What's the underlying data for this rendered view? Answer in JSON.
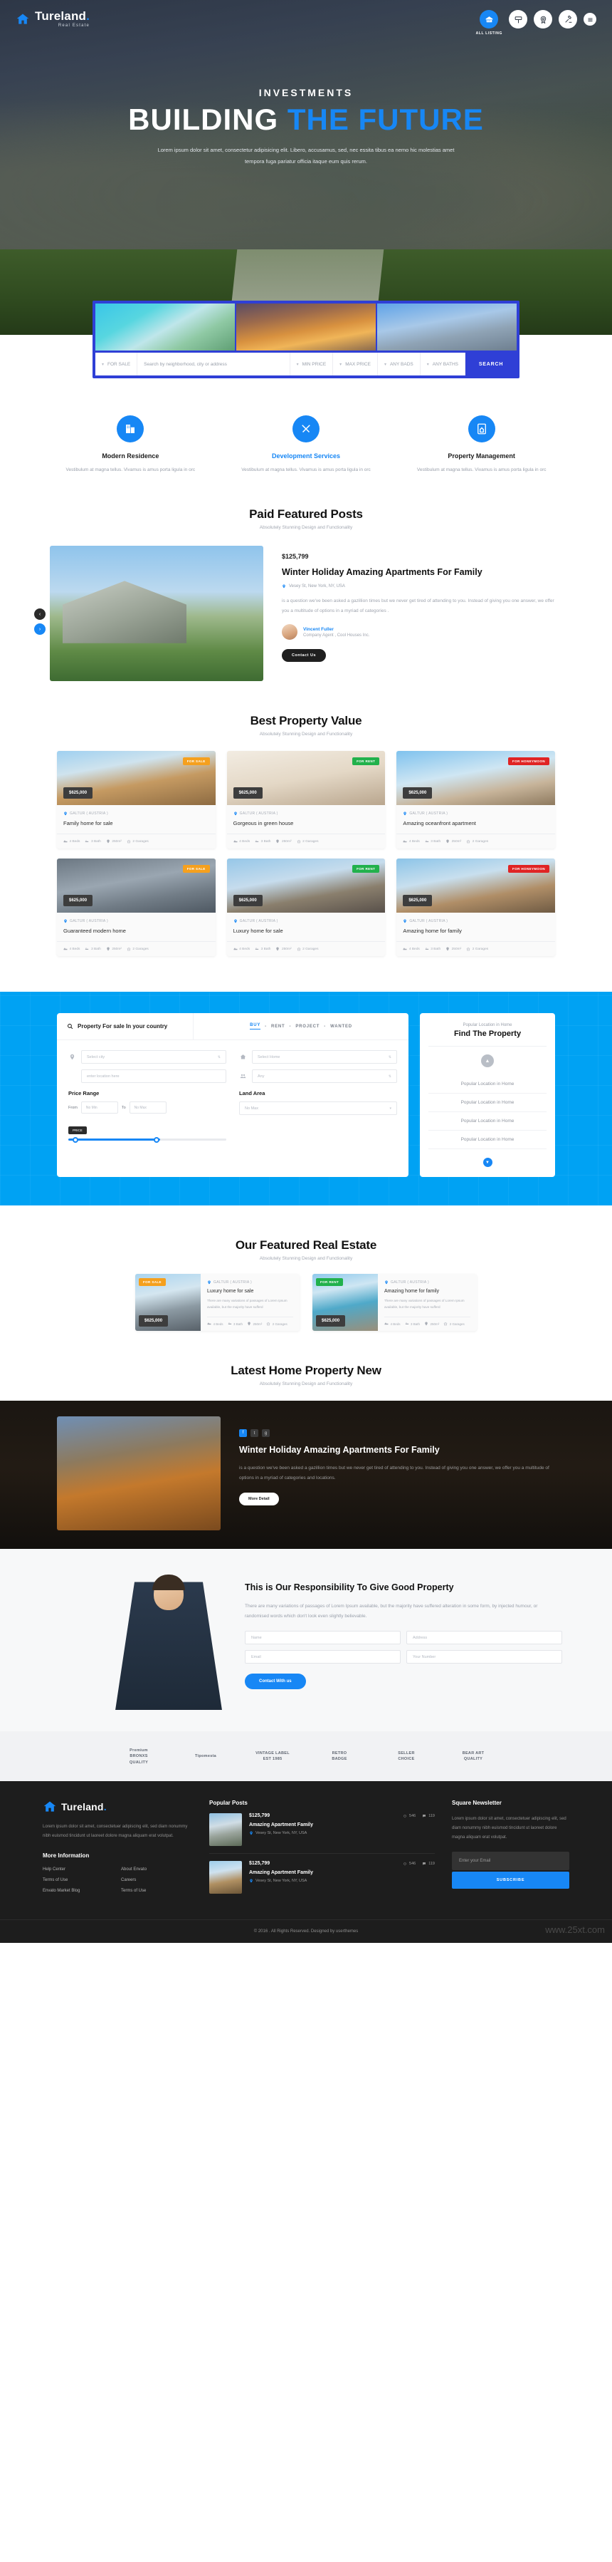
{
  "brand": {
    "name": "Tureland",
    "dot": ".",
    "tagline": "Real Estate"
  },
  "header": {
    "nav": [
      {
        "icon": "house-icon",
        "label": "ALL LISTING",
        "active": true
      },
      {
        "icon": "sign-board-icon",
        "label": "",
        "active": false
      },
      {
        "icon": "award-target-icon",
        "label": "",
        "active": false
      },
      {
        "icon": "gavel-icon",
        "label": "",
        "active": false
      }
    ],
    "menu_icon": "hamburger-menu-icon"
  },
  "hero": {
    "kicker": "INVESTMENTS",
    "title_white": "BUILDING",
    "title_accent": "THE FUTURE",
    "description": "Lorem ipsum dolor sit amet, consectetur adipisicing elit. Libero, accusamus, sed, nec essita tibus ea nemo hic molestias amet tempora fuga pariatur officia itaque eum quis rerum."
  },
  "search_bar": {
    "fields": [
      {
        "label": "FOR SALE",
        "type": "select"
      },
      {
        "label": "Search by neighborhood, city or address",
        "type": "text"
      },
      {
        "label": "MIN PRICE",
        "type": "select"
      },
      {
        "label": "MAX PRICE",
        "type": "select"
      },
      {
        "label": "ANY BADS",
        "type": "select"
      },
      {
        "label": "ANY BATHS",
        "type": "select"
      }
    ],
    "button": "SEARCH"
  },
  "services": [
    {
      "icon": "building-icon",
      "title": "Modern Residence",
      "desc": "Vestibulum at magna tellus. Vivamus is amus porta ligula in orc",
      "active": false
    },
    {
      "icon": "tools-icon",
      "title": "Development Services",
      "desc": "Vestibulum at magna tellus. Vivamus is amus porta ligula in orc",
      "active": true
    },
    {
      "icon": "home-document-icon",
      "title": "Property Management",
      "desc": "Vestibulum at magna tellus. Vivamus is amus porta ligula in orc",
      "active": false
    }
  ],
  "featured_section": {
    "title": "Paid Featured Posts",
    "subtitle": "Absolutely Stunning Design and Functionality",
    "post": {
      "price": "$125,799",
      "title": "Winter Holiday Amazing Apartments For Family",
      "location": "Vesey St, New York, NY, USA",
      "description": "is a question we've been asked a gazillion times but we never get tired of attending to you. Instead of giving you one answer, we offer you a multitude of options in a myriad of categories .",
      "agent_name": "Vincent Fuller",
      "agent_role": "Company Agent , Cool Houses Inc.",
      "button": "Contact Us"
    }
  },
  "best_value": {
    "title": "Best Property Value",
    "subtitle": "Absolutely Stunning Design and Functionality",
    "cards": [
      {
        "badge": "FOR SALE",
        "badge_type": "sale",
        "price": "$625,000",
        "location": "GALTUR ( AUSTRIA )",
        "title": "Family home for sale",
        "beds": "4 Beds",
        "bath": "3 Bath",
        "area": "250m²",
        "garage": "2 Garages"
      },
      {
        "badge": "FOR RENT",
        "badge_type": "rent",
        "price": "$625,000",
        "location": "GALTUR ( AUSTRIA )",
        "title": "Gorgeous in green house",
        "beds": "4 Beds",
        "bath": "3 Bath",
        "area": "250m²",
        "garage": "2 Garages"
      },
      {
        "badge": "FOR HONEYMOON",
        "badge_type": "honey",
        "price": "$625,000",
        "location": "GALTUR ( AUSTRIA )",
        "title": "Amazing oceanfront apartment",
        "beds": "4 Beds",
        "bath": "3 Bath",
        "area": "250m²",
        "garage": "2 Garages"
      },
      {
        "badge": "FOR SALE",
        "badge_type": "sale",
        "price": "$625,000",
        "location": "GALTUR ( AUSTRIA )",
        "title": "Guaranteed modern home",
        "beds": "4 Beds",
        "bath": "3 Bath",
        "area": "250m²",
        "garage": "2 Garages"
      },
      {
        "badge": "FOR RENT",
        "badge_type": "rent",
        "price": "$625,000",
        "location": "GALTUR ( AUSTRIA )",
        "title": "Luxury home for sale",
        "beds": "4 Beds",
        "bath": "3 Bath",
        "area": "250m²",
        "garage": "2 Garages"
      },
      {
        "badge": "FOR HONEYMOON",
        "badge_type": "honey",
        "price": "$625,000",
        "location": "GALTUR ( AUSTRIA )",
        "title": "Amazing home for family",
        "beds": "4 Beds",
        "bath": "3 Bath",
        "area": "250m²",
        "garage": "2 Garages"
      }
    ]
  },
  "blue_search": {
    "title": "Property For sale In your country",
    "tabs": [
      "BUY",
      "RENT",
      "PROJECT",
      "WANTED"
    ],
    "active_tab": "BUY",
    "city_placeholder": "Select city",
    "location_placeholder": "enter location here",
    "home_placeholder": "Select Home",
    "any_placeholder": "Any",
    "price_range_label": "Price Range",
    "from_label": "From",
    "to_label": "To",
    "no_min": "No Min",
    "no_max": "No Max",
    "land_area_label": "Land Area",
    "land_no_max": "No Max",
    "price_pill": "PRICE",
    "right_kicker": "Popular Location in Home",
    "right_title": "Find The Property",
    "right_items": [
      "Popular Location in Home",
      "Popular Location in Home",
      "Popular Location in Home",
      "Popular Location in Home"
    ]
  },
  "featured_estate": {
    "title": "Our Featured Real Estate",
    "subtitle": "Absolutely Stunning Design and Functionality",
    "cards": [
      {
        "badge": "FOR SALE",
        "badge_type": "sale",
        "price": "$625,000",
        "location": "GALTUR ( AUSTRIA )",
        "title": "Luxury home for sale",
        "desc": "There are many variations of passages of Lorem Ipsum available, but the majority have sufferd",
        "beds": "4 Beds",
        "bath": "3 Bath",
        "area": "250m²",
        "garage": "2 Garages"
      },
      {
        "badge": "FOR RENT",
        "badge_type": "rent",
        "price": "$625,000",
        "location": "GALTUR ( AUSTRIA )",
        "title": "Amazing home for family",
        "desc": "There are many variations of passages of Lorem Ipsum available, but the majority have sufferd",
        "beds": "4 Beds",
        "bath": "3 Bath",
        "area": "250m²",
        "garage": "2 Garages"
      }
    ]
  },
  "latest_news": {
    "title": "Latest Home Property New",
    "subtitle": "Absolutely Stunning Design and Functionality",
    "socials": [
      "facebook-icon",
      "twitter-icon",
      "google-plus-icon"
    ],
    "post_title": "Winter Holiday Amazing Apartments For Family",
    "post_desc": "is a question we've been asked a gazillion times but we never get tired of attending to you. Instead of giving you one answer, we offer you a multitude of options in a myriad of categories and locations.",
    "button": "More Detail"
  },
  "responsibility": {
    "title": "This is Our Responsibility To Give Good Property",
    "desc": "There are many variations of passages of Lorem Ipsum available, but the majority have suffered alteration in some form, by injected humour, or randomised words which don't look even slightly believable.",
    "fields": [
      {
        "placeholder": "Name"
      },
      {
        "placeholder": "Address"
      },
      {
        "placeholder": "Email"
      },
      {
        "placeholder": "Your Number"
      }
    ],
    "button": "Contact With us"
  },
  "partners": [
    {
      "label": "Premium\nBRONXS\nQUALITY"
    },
    {
      "label": "Tipomesta"
    },
    {
      "label": "VINTAGE LABEL\nEST 1985"
    },
    {
      "label": "RETRO\nBADGE"
    },
    {
      "label": "SELLER\nCHOICE"
    },
    {
      "label": "BEAR ART\nQUALITY"
    }
  ],
  "footer": {
    "about_text": "Lorem ipsum dolor sit amet, consectetuer adipiscing elit, sed diam nonummy nibh euismod tincidunt ut laoreet dolore magna aliquam erat volutpat.",
    "more_info_head": "More Information",
    "links": [
      "Help Center",
      "About Envato",
      "Terms of Use",
      "Careers",
      "Envato Market Blog",
      "Terms of Use"
    ],
    "popular_head": "Popular Posts",
    "posts": [
      {
        "price": "$125,799",
        "likes": "546",
        "comments": "119",
        "name": "Amazing Apartment Family",
        "location": "Vesey St, New York, NY, USA"
      },
      {
        "price": "$125,799",
        "likes": "546",
        "comments": "119",
        "name": "Amazing Apartment Family",
        "location": "Vesey St, New York, NY, USA"
      }
    ],
    "newsletter_head": "Square Newsletter",
    "newsletter_text": "Lorem ipsum dolor sit amet, consectetuer adipiscing elit, sed diam nonummy nibh euismod tincidunt ut laoreet dolore magna aliquam erat volutpat.",
    "email_placeholder": "Enter your Email",
    "subscribe": "SUBSCRIBE",
    "copyright": "© 2016 . All Rights Reserved. Designed by userthemes",
    "watermark": "www.25xt.com"
  }
}
